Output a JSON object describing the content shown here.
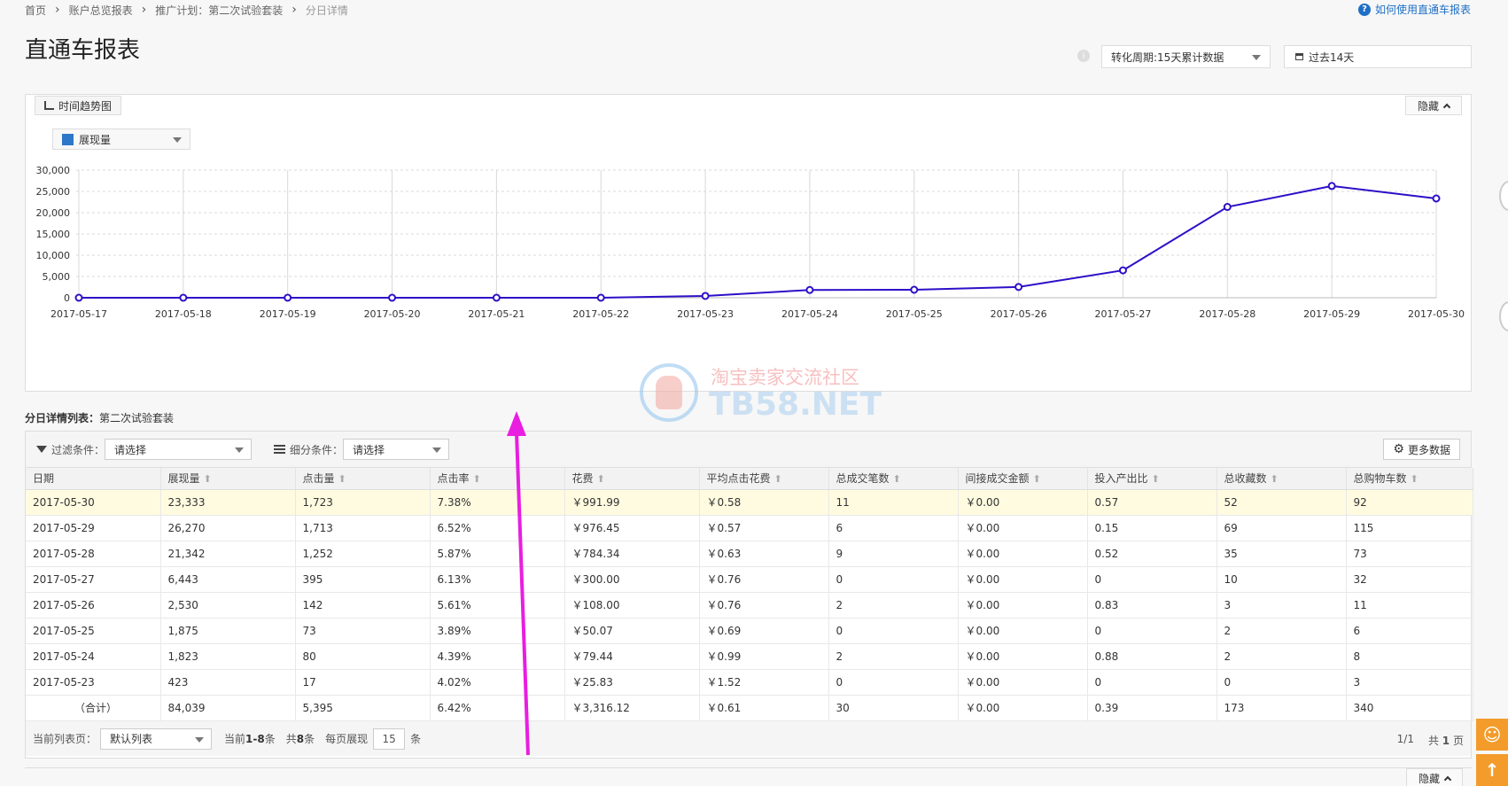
{
  "breadcrumb": {
    "items": [
      "首页",
      "账户总览报表",
      "推广计划：第二次试验套装",
      "分日详情"
    ]
  },
  "help_link": "如何使用直通车报表",
  "page_title": "直通车报表",
  "period_select": "转化周期:15天累计数据",
  "date_range": "过去14天",
  "chart_panel": {
    "tab_label": "时间趋势图",
    "hide_label": "隐藏",
    "metric_select": "展现量",
    "series_color": "#2d0fc8",
    "swatch_color": "#2d78c8"
  },
  "chart_data": {
    "type": "line",
    "x": [
      "2017-05-17",
      "2017-05-18",
      "2017-05-19",
      "2017-05-20",
      "2017-05-21",
      "2017-05-22",
      "2017-05-23",
      "2017-05-24",
      "2017-05-25",
      "2017-05-26",
      "2017-05-27",
      "2017-05-28",
      "2017-05-29",
      "2017-05-30"
    ],
    "series": [
      {
        "name": "展现量",
        "values": [
          0,
          0,
          0,
          0,
          0,
          0,
          423,
          1823,
          1875,
          2530,
          6443,
          21342,
          26270,
          23333
        ]
      }
    ],
    "yticks": [
      "30,000",
      "25,000",
      "20,000",
      "15,000",
      "10,000",
      "5,000",
      "0"
    ],
    "ylim": [
      0,
      30000
    ],
    "grid": true
  },
  "list_title": {
    "prefix": "分日详情列表：",
    "plan": "第二次试验套装"
  },
  "filter_bar": {
    "filter_label": "过滤条件：",
    "filter_value": "请选择",
    "segment_label": "细分条件：",
    "segment_value": "请选择",
    "more_label": "更多数据"
  },
  "table": {
    "columns": [
      "日期",
      "展现量",
      "点击量",
      "点击率",
      "花费",
      "平均点击花费",
      "总成交笔数",
      "间接成交金额",
      "投入产出比",
      "总收藏数",
      "总购物车数"
    ],
    "rows": [
      [
        "2017-05-30",
        "23,333",
        "1,723",
        "7.38%",
        "￥991.99",
        "￥0.58",
        "11",
        "￥0.00",
        "0.57",
        "52",
        "92"
      ],
      [
        "2017-05-29",
        "26,270",
        "1,713",
        "6.52%",
        "￥976.45",
        "￥0.57",
        "6",
        "￥0.00",
        "0.15",
        "69",
        "115"
      ],
      [
        "2017-05-28",
        "21,342",
        "1,252",
        "5.87%",
        "￥784.34",
        "￥0.63",
        "9",
        "￥0.00",
        "0.52",
        "35",
        "73"
      ],
      [
        "2017-05-27",
        "6,443",
        "395",
        "6.13%",
        "￥300.00",
        "￥0.76",
        "0",
        "￥0.00",
        "0",
        "10",
        "32"
      ],
      [
        "2017-05-26",
        "2,530",
        "142",
        "5.61%",
        "￥108.00",
        "￥0.76",
        "2",
        "￥0.00",
        "0.83",
        "3",
        "11"
      ],
      [
        "2017-05-25",
        "1,875",
        "73",
        "3.89%",
        "￥50.07",
        "￥0.69",
        "0",
        "￥0.00",
        "0",
        "2",
        "6"
      ],
      [
        "2017-05-24",
        "1,823",
        "80",
        "4.39%",
        "￥79.44",
        "￥0.99",
        "2",
        "￥0.00",
        "0.88",
        "2",
        "8"
      ],
      [
        "2017-05-23",
        "423",
        "17",
        "4.02%",
        "￥25.83",
        "￥1.52",
        "0",
        "￥0.00",
        "0",
        "0",
        "3"
      ]
    ],
    "total": [
      "（合计）",
      "84,039",
      "5,395",
      "6.42%",
      "￥3,316.12",
      "￥0.61",
      "30",
      "￥0.00",
      "0.39",
      "173",
      "340"
    ]
  },
  "pager": {
    "list_label": "当前列表页：",
    "list_value": "默认列表",
    "current_prefix": "当前",
    "current_range": "1-8",
    "current_suffix": "条",
    "total_prefix": "共",
    "total_count": "8",
    "total_suffix": "条",
    "per_page_label": "每页展现",
    "per_page_value": "15",
    "per_page_suffix": "条",
    "page_of": "1/1",
    "pages_prefix": "共",
    "pages_count": "1",
    "pages_suffix": "页"
  },
  "bottom_hide_label": "隐藏",
  "watermark": {
    "cn": "淘宝卖家交流社区",
    "en": "TB58.NET"
  },
  "annotation_arrow_color": "#e81ee0",
  "side_float": {
    "top_icon": "chat-icon",
    "bottom_icon": "arrow-up-icon",
    "color": "#f39c2b"
  }
}
